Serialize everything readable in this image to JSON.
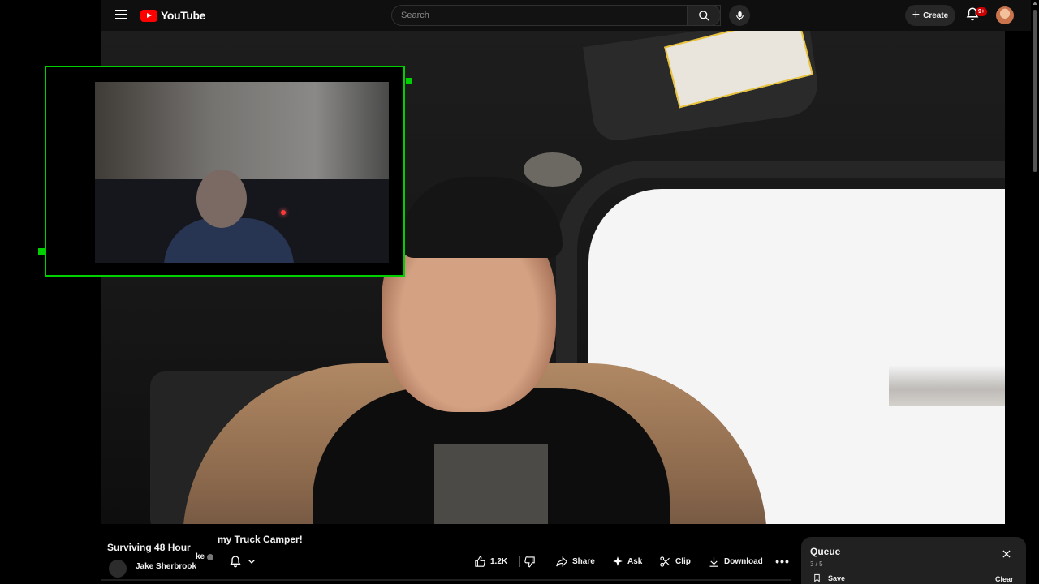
{
  "header": {
    "logo_text": "YouTube",
    "search_placeholder": "Search",
    "create_label": "Create",
    "notification_badge": "9+"
  },
  "video": {
    "title_start": "Surviving 48 Hour",
    "title_end": "my Truck Camper!",
    "channel_name": "Jake Sherbrook",
    "channel_name_fragment": "ke"
  },
  "actions": {
    "like_count": "1.2K",
    "share_label": "Share",
    "ask_label": "Ask",
    "clip_label": "Clip",
    "download_label": "Download"
  },
  "queue": {
    "title": "Queue",
    "count": "3 / 5",
    "save_label": "Save",
    "clear_label": "Clear"
  },
  "colors": {
    "brand_red": "#ff0000",
    "overlay_green": "#00d000",
    "background": "#0f0f0f"
  }
}
